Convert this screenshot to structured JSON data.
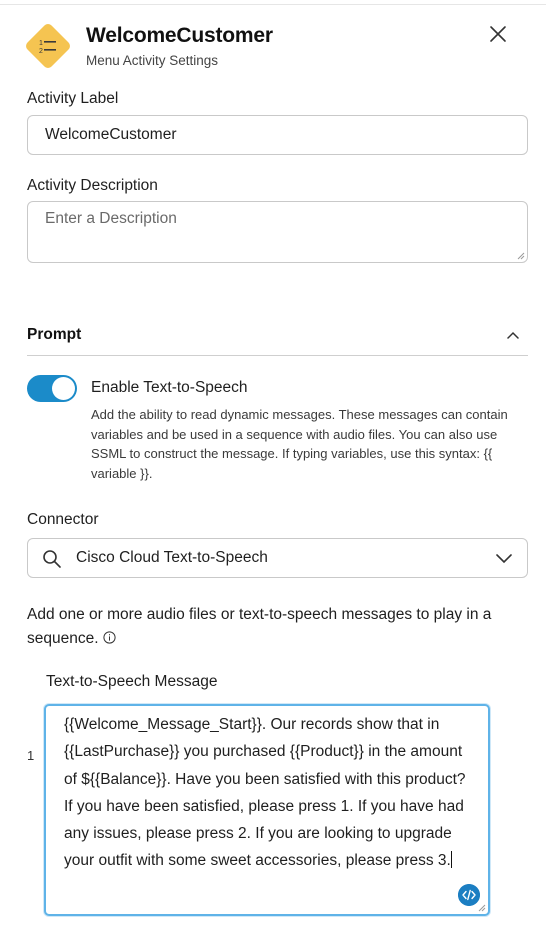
{
  "header": {
    "title": "WelcomeCustomer",
    "subtitle": "Menu Activity Settings",
    "icon": "menu-list-icon",
    "accent_color": "#f5c451"
  },
  "activity_label": {
    "label": "Activity Label",
    "value": "WelcomeCustomer"
  },
  "activity_description": {
    "label": "Activity Description",
    "placeholder": "Enter a Description"
  },
  "prompt": {
    "title": "Prompt",
    "expanded": true,
    "tts_toggle": {
      "label": "Enable Text-to-Speech",
      "enabled": true,
      "color": "#1b8bc9",
      "help": "Add the ability to read dynamic messages. These messages can contain variables and be used in a sequence with audio files. You can also use SSML to construct the message. If typing variables, use this syntax: {{ variable }}."
    },
    "connector": {
      "label": "Connector",
      "value": "Cisco Cloud Text-to-Speech"
    },
    "audio_description": "Add one or more audio files or text-to-speech messages to play in a sequence.",
    "tts_message": {
      "label": "Text-to-Speech Message",
      "line_number": "1",
      "text": "{{Welcome_Message_Start}}.  Our records show that in {{LastPurchase}} you purchased {{Product}} in the amount of ${{Balance}}.  Have you been satisfied with this product? If you have been satisfied, please press 1. If you have had any issues, please press 2. If you are looking to upgrade your outfit with some sweet accessories, please press 3."
    }
  }
}
